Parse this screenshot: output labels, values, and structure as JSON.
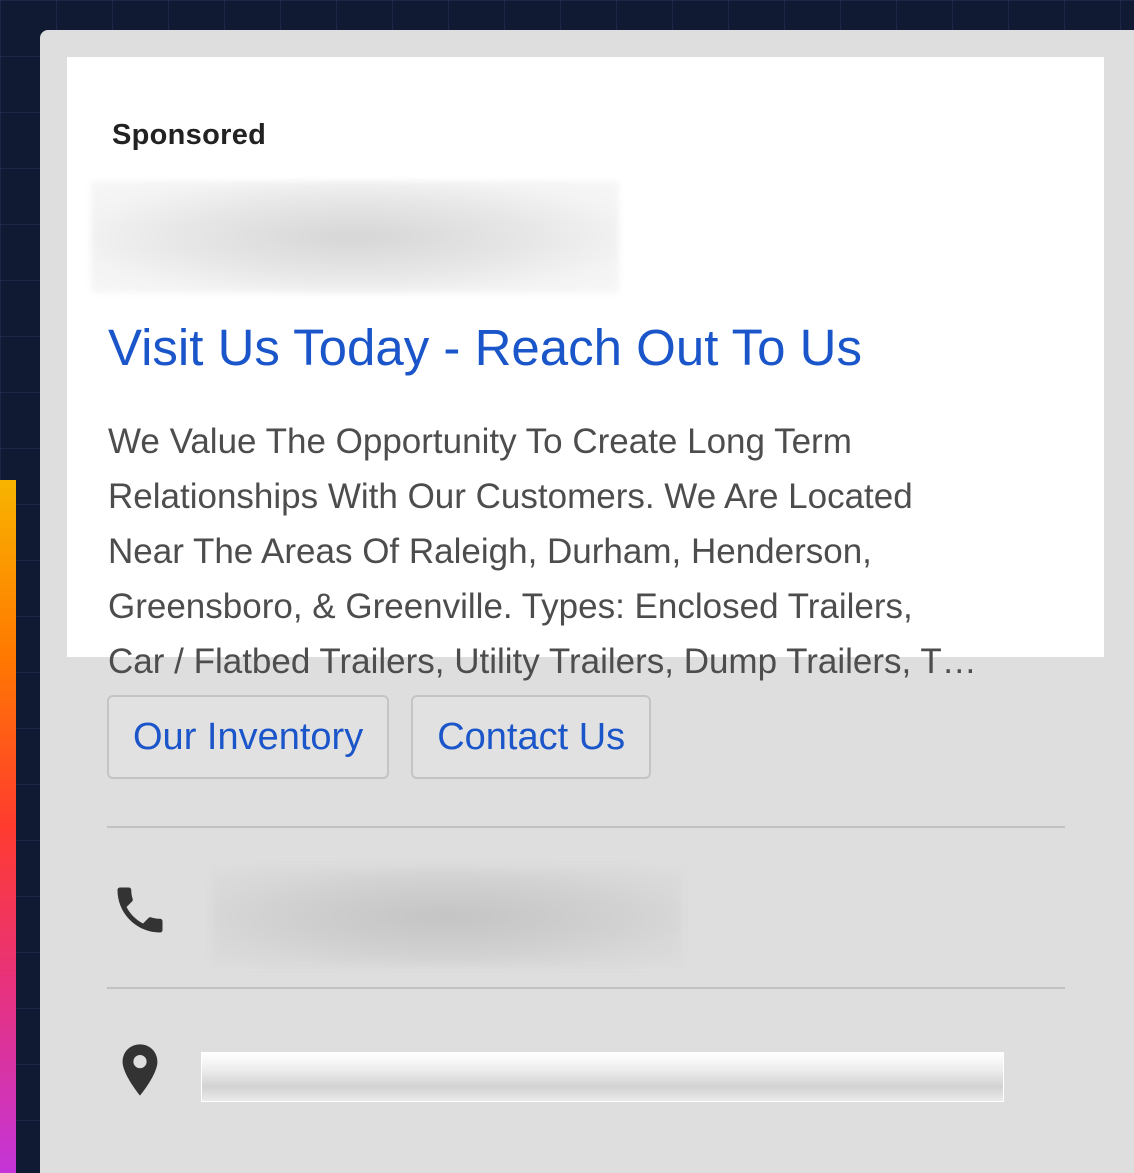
{
  "ad": {
    "sponsored_label": "Sponsored",
    "headline": "Visit Us Today - Reach Out To Us",
    "description_lines": [
      "We Value The Opportunity To Create Long Term",
      "Relationships With Our Customers. We Are Located",
      "Near The Areas Of Raleigh, Durham, Henderson,",
      "Greensboro, & Greenville. Types: Enclosed Trailers,",
      "Car / Flatbed Trailers, Utility Trailers, Dump Trailers, T…"
    ],
    "sitelinks": [
      {
        "label": "Our Inventory"
      },
      {
        "label": "Contact Us"
      }
    ],
    "phone_icon": "phone-icon",
    "location_icon": "location-pin-icon"
  },
  "colors": {
    "link_blue": "#1a55c9",
    "card_gray": "#dedede",
    "page_background": "#101a33"
  }
}
